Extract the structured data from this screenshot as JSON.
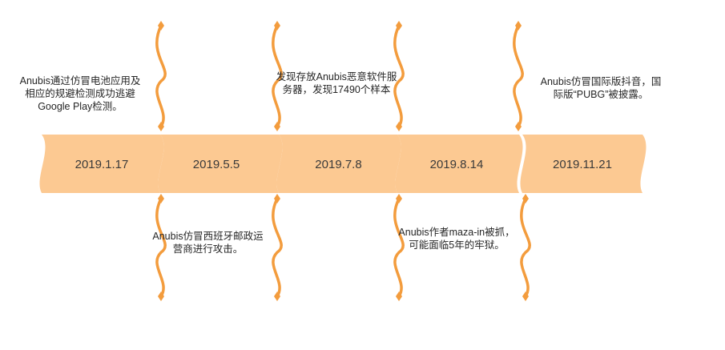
{
  "accent_color": "#f39c3d",
  "band_color": "#fcc992",
  "events": [
    {
      "date": "2019.1.17",
      "position": "top",
      "text": "Anubis通过仿冒电池应用及相应的规避检测成功逃避Google Play检测。"
    },
    {
      "date": "2019.5.5",
      "position": "bottom",
      "text": "Anubis仿冒西班牙邮政运营商进行攻击。"
    },
    {
      "date": "2019.7.8",
      "position": "top",
      "text": "发现存放Anubis恶意软件服务器，发现17490个样本"
    },
    {
      "date": "2019.8.14",
      "position": "bottom",
      "text": "Anubis作者maza-in被抓，可能面临5年的牢狱。"
    },
    {
      "date": "2019.11.21",
      "position": "top",
      "text": "Anubis仿冒国际版抖音，国际版“PUBG”被披露。"
    }
  ]
}
